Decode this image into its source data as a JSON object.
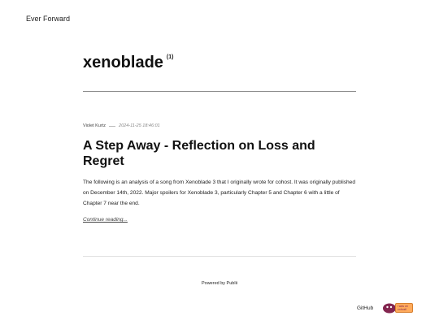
{
  "site": {
    "title": "Ever Forward"
  },
  "tag": {
    "name": "xenoblade",
    "count": "(1)"
  },
  "post": {
    "author": "Violet Kurtz",
    "date": "2024-11-25 18:46:01",
    "title": "A Step Away - Reflection on Loss and Regret",
    "excerpt": "The following is an analysis of a song from Xenoblade 3 that I originally wrote for cohost. It was originally published on December 14th, 2022. Major spoilers for Xenoblade 3, particularly Chapter 5 and Chapter 6 with a little of Chapter 7 near the end.",
    "read_more": "Continue reading..."
  },
  "footer": {
    "powered_by": "Powered by Publii",
    "github_label": "GitHub",
    "cohost_badge_text": "i was on cohost!",
    "cohost_icon": "eggbug-icon"
  },
  "colors": {
    "cohost_badge": "#ffab5c",
    "eggbug": "#83254f"
  }
}
